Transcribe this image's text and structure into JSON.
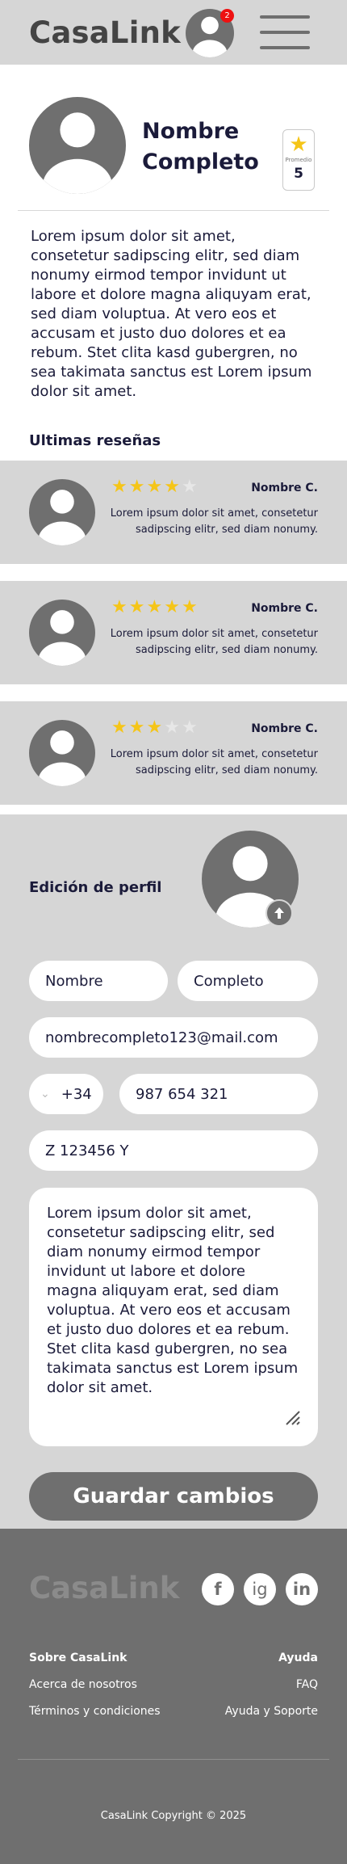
{
  "header": {
    "logo": "CasaLink",
    "notification_count": "2"
  },
  "profile": {
    "name": "Nombre Completo",
    "rating_label": "Promedio",
    "rating_value": "5"
  },
  "bio": "Lorem ipsum dolor sit amet, consetetur sadipscing elitr, sed diam nonumy eirmod tempor invidunt ut labore et dolore magna aliquyam erat, sed diam voluptua. At vero eos et accusam et justo duo dolores et ea rebum. Stet clita kasd gubergren, no sea takimata sanctus est Lorem ipsum dolor sit amet.",
  "reviews_title": "Ultimas reseñas",
  "reviews": [
    {
      "name": "Nombre C.",
      "stars": 4,
      "text": "Lorem ipsum dolor sit amet, consetetur sadipscing elitr, sed diam nonumy."
    },
    {
      "name": "Nombre C.",
      "stars": 5,
      "text": "Lorem ipsum dolor sit amet, consetetur sadipscing elitr, sed diam nonumy."
    },
    {
      "name": "Nombre C.",
      "stars": 3,
      "text": "Lorem ipsum dolor sit amet, consetetur sadipscing elitr, sed diam nonumy."
    }
  ],
  "edit": {
    "title": "Edición de perfil",
    "first_name": "Nombre",
    "last_name": "Completo",
    "email": "nombrecompleto123@mail.com",
    "phone_prefix": "+34",
    "phone": "987 654 321",
    "id_number": "Z 123456 Y",
    "description": "Lorem ipsum dolor sit amet, consetetur sadipscing elitr, sed diam nonumy eirmod tempor invidunt ut labore et dolore magna aliquyam erat, sed diam voluptua. At vero eos et accusam et justo duo dolores et ea rebum. Stet clita kasd gubergren, no sea takimata sanctus est Lorem ipsum dolor sit amet.",
    "save_label": "Guardar cambios"
  },
  "footer": {
    "logo": "CasaLink",
    "social": {
      "facebook": "f",
      "instagram": "ig",
      "linkedin": "in"
    },
    "about_heading": "Sobre CasaLink",
    "about_links": [
      "Acerca de nosotros",
      "Términos y condiciones"
    ],
    "help_heading": "Ayuda",
    "help_links": [
      "FAQ",
      "Ayuda y Soporte"
    ],
    "copyright": "CasaLink Copyright © 2025"
  },
  "colors": {
    "header_bg": "#d6d6d6",
    "dark_gray": "#6f6f6f",
    "star": "#f5c518",
    "badge": "#e11111",
    "text": "#1b1b3a"
  }
}
